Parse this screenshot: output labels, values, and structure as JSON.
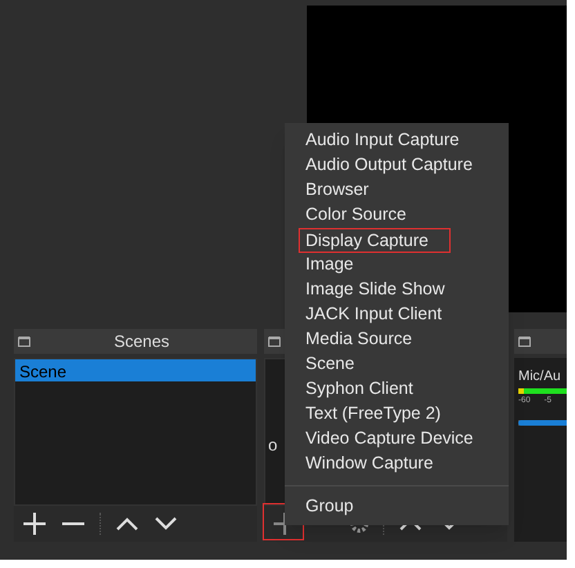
{
  "scenes": {
    "title": "Scenes",
    "items": [
      {
        "label": "Scene",
        "selected": true
      }
    ]
  },
  "sources": {
    "fragment": "o"
  },
  "mixer": {
    "title": "Mic/Au",
    "ticks": [
      "-60",
      "-5"
    ],
    "level": 1
  },
  "add_menu": {
    "items": [
      {
        "kind": "item",
        "label": "Audio Input Capture",
        "outlined": false
      },
      {
        "kind": "item",
        "label": "Audio Output Capture",
        "outlined": false
      },
      {
        "kind": "item",
        "label": "Browser",
        "outlined": false
      },
      {
        "kind": "item",
        "label": "Color Source",
        "outlined": false
      },
      {
        "kind": "item",
        "label": "Display Capture",
        "outlined": true
      },
      {
        "kind": "item",
        "label": "Image",
        "outlined": false
      },
      {
        "kind": "item",
        "label": "Image Slide Show",
        "outlined": false
      },
      {
        "kind": "item",
        "label": "JACK Input Client",
        "outlined": false
      },
      {
        "kind": "item",
        "label": "Media Source",
        "outlined": false
      },
      {
        "kind": "item",
        "label": "Scene",
        "outlined": false
      },
      {
        "kind": "item",
        "label": "Syphon Client",
        "outlined": false
      },
      {
        "kind": "item",
        "label": "Text (FreeType 2)",
        "outlined": false
      },
      {
        "kind": "item",
        "label": "Video Capture Device",
        "outlined": false
      },
      {
        "kind": "item",
        "label": "Window Capture",
        "outlined": false
      },
      {
        "kind": "separator"
      },
      {
        "kind": "item",
        "label": "Group",
        "outlined": false
      }
    ]
  }
}
